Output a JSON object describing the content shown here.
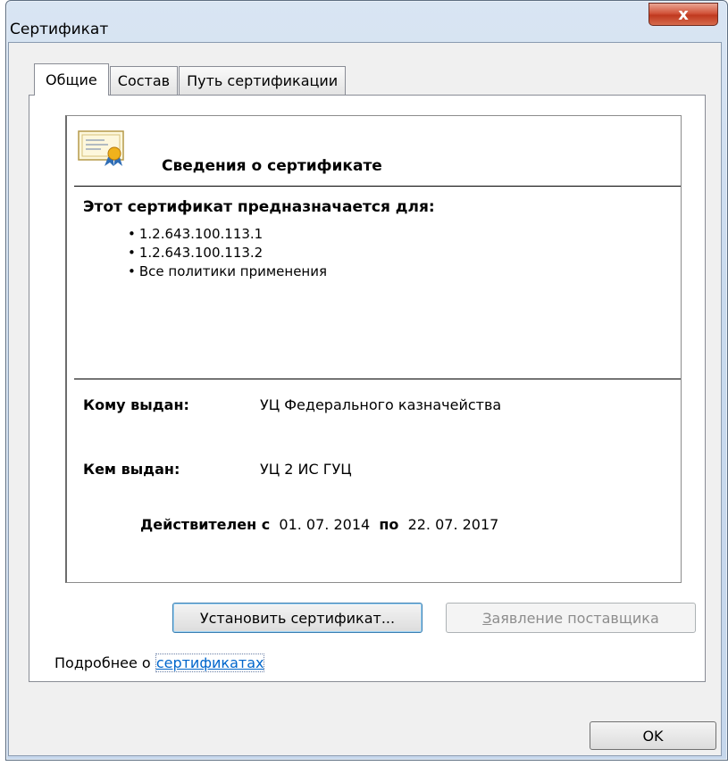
{
  "window": {
    "title": "Сертификат",
    "close_label": "x"
  },
  "tabs": [
    {
      "label": "Общие"
    },
    {
      "label": "Состав"
    },
    {
      "label": "Путь сертификации"
    }
  ],
  "info": {
    "header": "Сведения о сертификате",
    "purpose_title": "Этот сертификат предназначается для:",
    "purposes": [
      "1.2.643.100.113.1",
      "1.2.643.100.113.2",
      "Все политики применения"
    ],
    "issued_to_label": "Кому выдан:",
    "issued_to_value": "УЦ Федерального казначейства",
    "issued_by_label": "Кем выдан:",
    "issued_by_value": "УЦ 2 ИС ГУЦ",
    "valid_from_label": "Действителен с",
    "valid_from": "01. 07. 2014",
    "valid_to_label": "по",
    "valid_to": "22. 07. 2017"
  },
  "buttons": {
    "install": "Установить сертификат...",
    "issuer_statement_first": "З",
    "issuer_statement_rest": "аявление поставщика",
    "ok": "OK"
  },
  "more": {
    "text": "Подробнее о ",
    "link": "сертификатах"
  }
}
